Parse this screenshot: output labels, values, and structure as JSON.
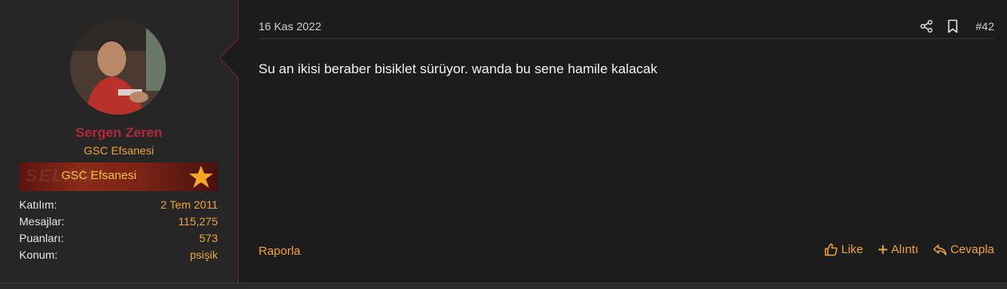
{
  "user": {
    "name": "Sergen Zeren",
    "title": "GSC Efsanesi",
    "banner_label": "GSC Efsanesi",
    "stats": [
      {
        "label": "Katılım:",
        "value": "2 Tem 2011"
      },
      {
        "label": "Mesajlar:",
        "value": "115,275"
      },
      {
        "label": "Puanları:",
        "value": "573"
      },
      {
        "label": "Konum:",
        "value": "psişik"
      }
    ]
  },
  "post": {
    "date": "16 Kas 2022",
    "number": "#42",
    "message": "Su an ikisi beraber bisiklet sürüyor. wanda bu sene hamile kalacak"
  },
  "actions": {
    "report": "Raporla",
    "like": "Like",
    "quote": "Alıntı",
    "reply": "Cevapla"
  },
  "colors": {
    "accent": "#f0a23a",
    "username": "#b5263b",
    "border": "#7a2230",
    "background": "#1c1c1c"
  },
  "icons": {
    "share": "share-icon",
    "bookmark": "bookmark-icon",
    "like": "thumbs-up-icon",
    "quote": "plus-icon",
    "reply": "reply-icon"
  }
}
